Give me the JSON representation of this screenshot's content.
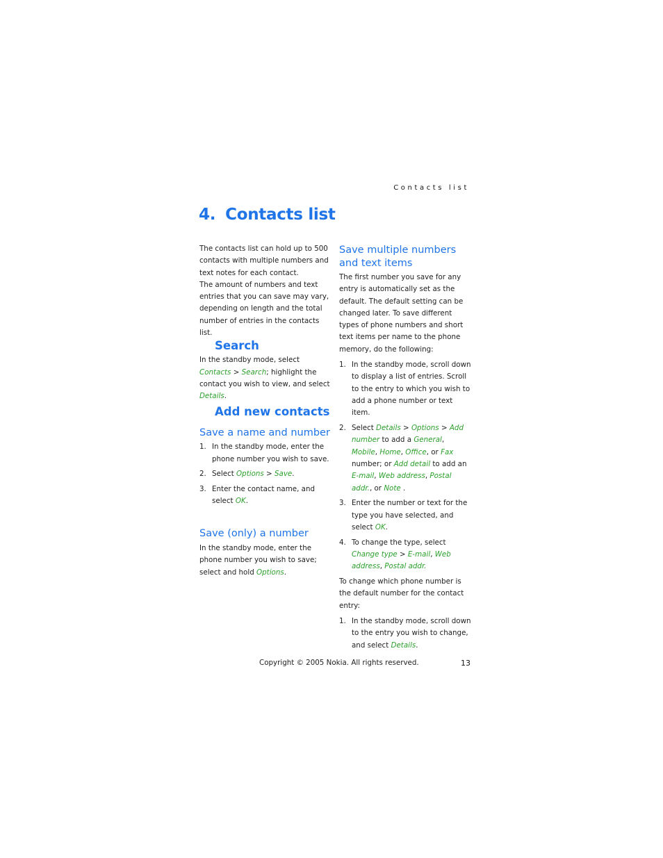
{
  "header": {
    "running_head": "Contacts list"
  },
  "chapter": {
    "number": "4.",
    "title": "Contacts list"
  },
  "intro": {
    "p1": "The contacts list can hold up to 500 contacts with multiple numbers and text notes for each contact.",
    "p2": "The amount of numbers and text entries that you can save may vary, depending on length and the total number of entries in the contacts list."
  },
  "search": {
    "heading": "Search",
    "t1": "In the standby mode, select ",
    "m1": "Contacts",
    "sep1": " > ",
    "m2": "Search",
    "t2": "; highlight the contact you wish to view, and select ",
    "m3": "Details",
    "t3": "."
  },
  "add_new": {
    "heading": "Add new contacts",
    "save_name": {
      "heading": "Save a name and number",
      "steps": [
        {
          "n": "1.",
          "text": "In the standby mode, enter the phone number you wish to save."
        },
        {
          "n": "2.",
          "t1": "Select ",
          "m1": "Options",
          "sep": " > ",
          "m2": "Save",
          "t2": "."
        },
        {
          "n": "3.",
          "t1": "Enter the contact name, and select ",
          "m1": "OK",
          "t2": "."
        }
      ]
    },
    "save_only": {
      "heading": "Save (only) a number",
      "t1": "In the standby mode, enter the phone number you wish to save; select and hold ",
      "m1": "Options",
      "t2": "."
    }
  },
  "save_multiple": {
    "heading": "Save multiple numbers and text items",
    "intro": "The first number you save for any entry is automatically set as the default. The default setting can be changed later. To save different types of phone numbers and short text items per name to the phone memory, do the following:",
    "steps": [
      {
        "n": "1.",
        "text": "In the standby mode, scroll down to display a list of entries. Scroll to the entry to which you wish to add a phone number or text item."
      },
      {
        "n": "2.",
        "t_select": "Select ",
        "m_details": "Details",
        "m_options": "Options",
        "m_add_number": "Add number",
        "t_to_add_a": " to add a ",
        "m_general": "General",
        "m_mobile": "Mobile",
        "m_home": "Home",
        "m_office": "Office",
        "t_or": ", or ",
        "m_fax": "Fax",
        "t_number_or": " number; or ",
        "m_add_detail": "Add detail",
        "t_to_add_an": " to add an ",
        "m_email": "E-mail",
        "m_web": "Web address",
        "m_postal": "Postal addr.",
        "t_or2": ", or ",
        "m_note": "Note",
        "t_end": " ."
      },
      {
        "n": "3.",
        "t1": "Enter the number or text for the type you have selected, and select ",
        "m1": "OK",
        "t2": "."
      },
      {
        "n": "4.",
        "t1": "To change the type, select ",
        "m1": "Change type",
        "sep": " > ",
        "m2": "E-mail",
        "m3": "Web address",
        "m4": "Postal addr."
      }
    ],
    "default_intro": "To change which phone number is the default number for the contact entry:",
    "default_steps": [
      {
        "n": "1.",
        "t1": "In the standby mode, scroll down to the entry you wish to change, and select ",
        "m1": "Details",
        "t2": "."
      }
    ]
  },
  "footer": {
    "copyright": "Copyright © 2005 Nokia. All rights reserved.",
    "page_number": "13"
  },
  "colors": {
    "heading_blue": "#1f74e8",
    "menu_green": "#2ca02c"
  }
}
